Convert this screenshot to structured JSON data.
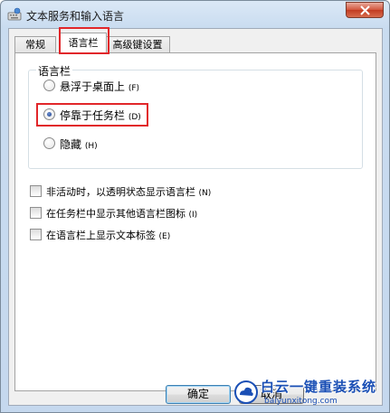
{
  "window": {
    "title": "文本服务和输入语言",
    "icon": "keyboard-app-icon"
  },
  "tabs": [
    {
      "label": "常规",
      "active": false
    },
    {
      "label": "语言栏",
      "active": true
    },
    {
      "label": "高级键设置",
      "active": false
    }
  ],
  "language_bar_group": {
    "label": "语言栏",
    "options": [
      {
        "label": "悬浮于桌面上",
        "hotkey": "(F)",
        "checked": false
      },
      {
        "label": "停靠于任务栏",
        "hotkey": "(D)",
        "checked": true
      },
      {
        "label": "隐藏",
        "hotkey": "(H)",
        "checked": false
      }
    ]
  },
  "checkboxes": [
    {
      "label": "非活动时，以透明状态显示语言栏",
      "hotkey": "(N)",
      "checked": false
    },
    {
      "label": "在任务栏中显示其他语言栏图标",
      "hotkey": "(I)",
      "checked": false
    },
    {
      "label": "在语言栏上显示文本标签",
      "hotkey": "(E)",
      "checked": false
    }
  ],
  "buttons": {
    "ok": "确定",
    "cancel": "取消"
  },
  "watermark": {
    "text": "白云一键重装系统",
    "url": "baiyunxitong.com"
  },
  "colors": {
    "highlight": "#e1262a",
    "titlebar": "#c9dcf0",
    "watermark": "#1a4fb5"
  }
}
